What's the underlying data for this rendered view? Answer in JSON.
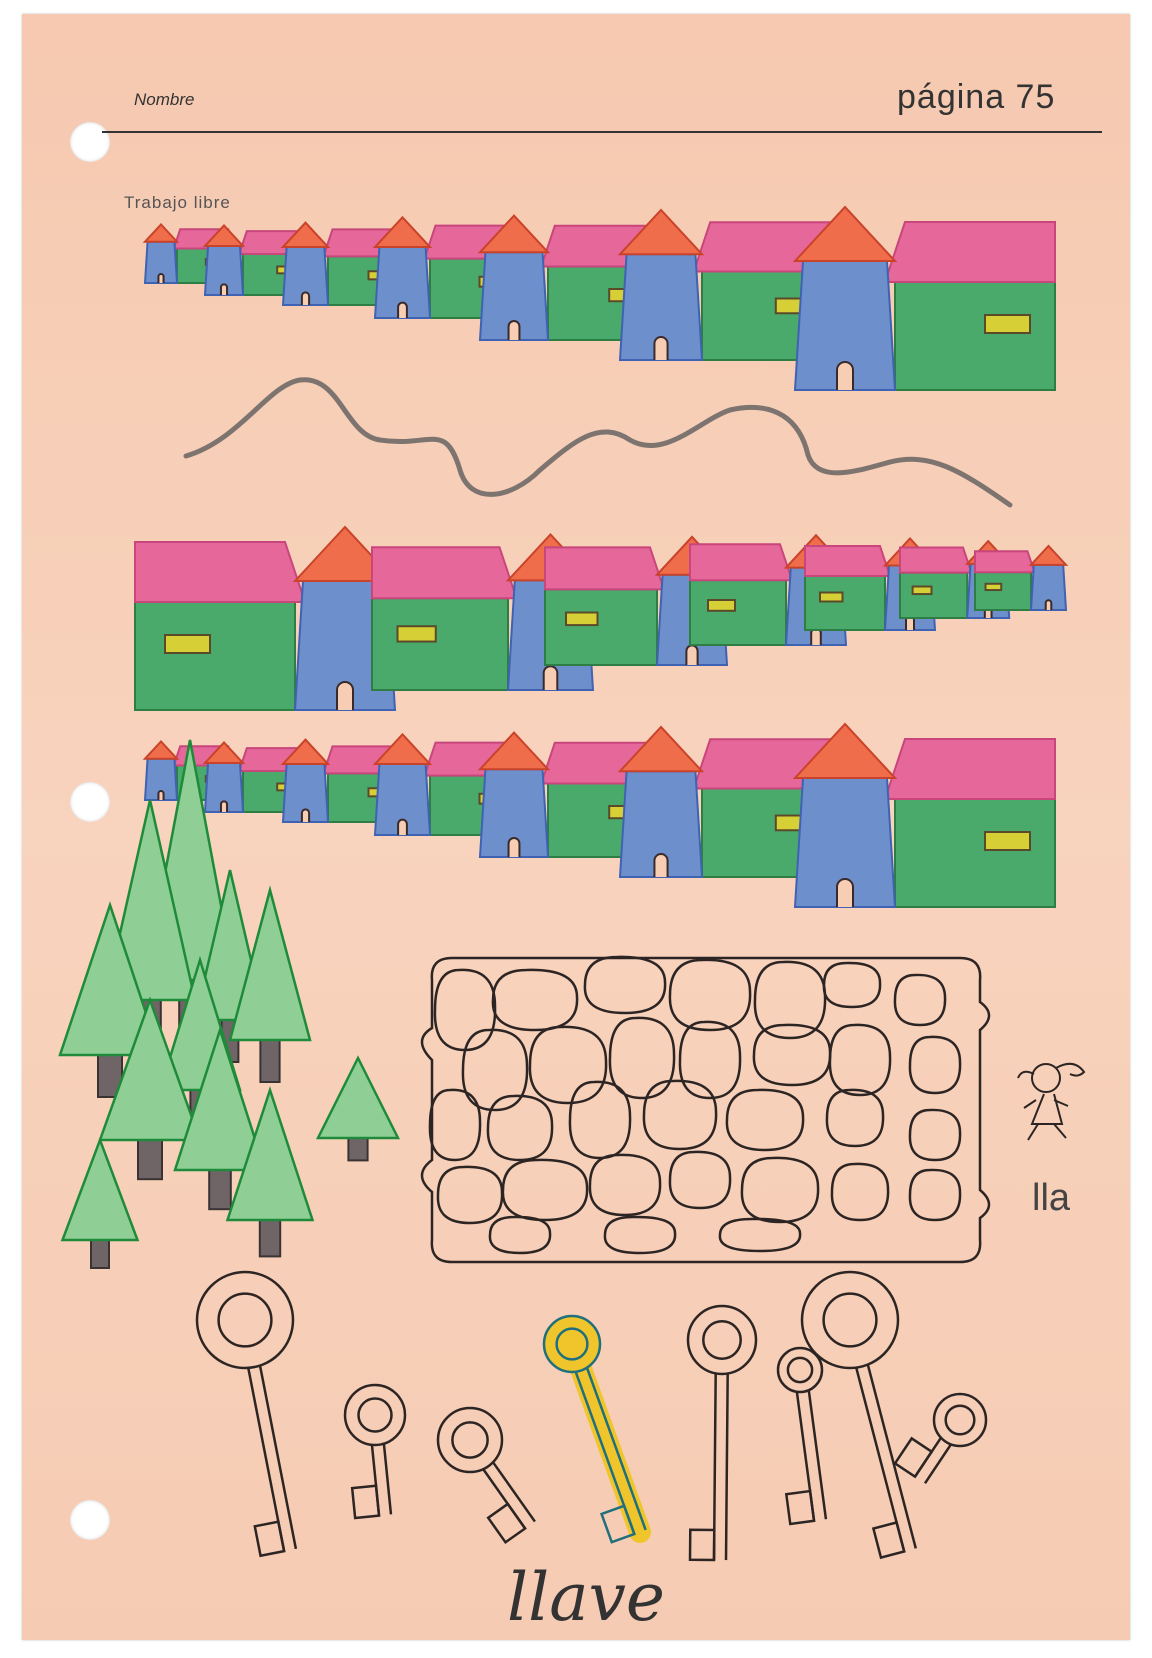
{
  "header": {
    "name_label": "Nombre",
    "page_label": "página 75"
  },
  "section": {
    "title": "Trabajo libre"
  },
  "exercise": {
    "syllable": "lla",
    "word": "llave"
  },
  "icons": [
    "house-drawing",
    "tree-drawing",
    "stone-wall-drawing",
    "girl-drawing",
    "key-drawing",
    "wavy-line"
  ]
}
